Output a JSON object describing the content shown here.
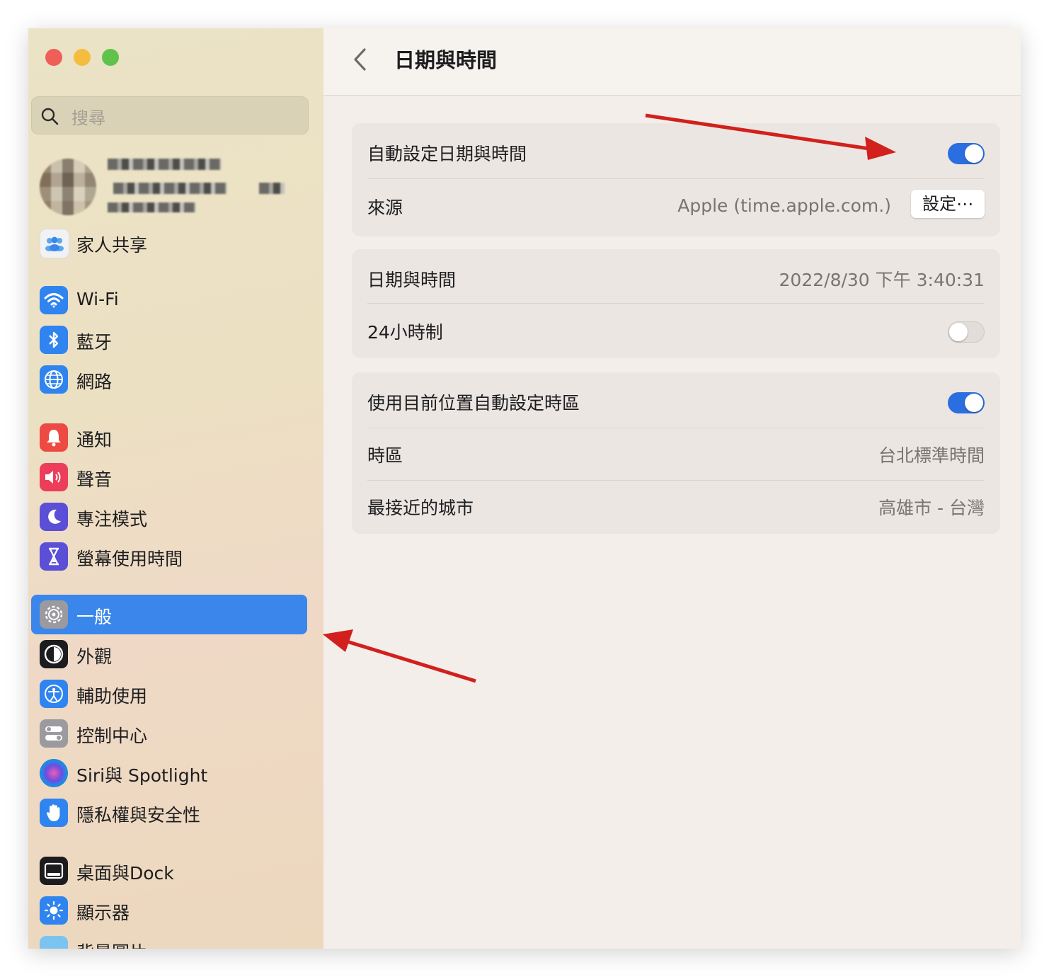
{
  "window": {
    "search_placeholder": "搜尋",
    "page_title": "日期與時間"
  },
  "sidebar": {
    "items": [
      {
        "label": "家人共享"
      },
      {
        "label": "Wi-Fi"
      },
      {
        "label": "藍牙"
      },
      {
        "label": "網路"
      },
      {
        "label": "通知"
      },
      {
        "label": "聲音"
      },
      {
        "label": "專注模式"
      },
      {
        "label": "螢幕使用時間"
      },
      {
        "label": "一般"
      },
      {
        "label": "外觀"
      },
      {
        "label": "輔助使用"
      },
      {
        "label": "控制中心"
      },
      {
        "label": "Siri與 Spotlight"
      },
      {
        "label": "隱私權與安全性"
      },
      {
        "label": "桌面與Dock"
      },
      {
        "label": "顯示器"
      },
      {
        "label": "背景圖片"
      }
    ],
    "selected": "一般"
  },
  "settings": {
    "auto": {
      "label": "自動設定日期與時間",
      "enabled": true,
      "source_label": "來源",
      "source_value": "Apple (time.apple.com.)",
      "set_button": "設定⋯"
    },
    "datetime": {
      "label": "日期與時間",
      "value": "2022/8/30 下午 3:40:31",
      "hour24_label": "24小時制",
      "hour24_enabled": false
    },
    "timezone": {
      "auto_label": "使用目前位置自動設定時區",
      "auto_enabled": true,
      "tz_label": "時區",
      "tz_value": "台北標準時間",
      "city_label": "最接近的城市",
      "city_value": "高雄市 - 台灣"
    }
  },
  "colors": {
    "accent": "#3b86eb",
    "toggle_on": "#2a6edf",
    "annotation_arrow": "#d2201c",
    "close": "#ee5f57",
    "minimize": "#f5bd3e",
    "zoom": "#5fc24a"
  }
}
